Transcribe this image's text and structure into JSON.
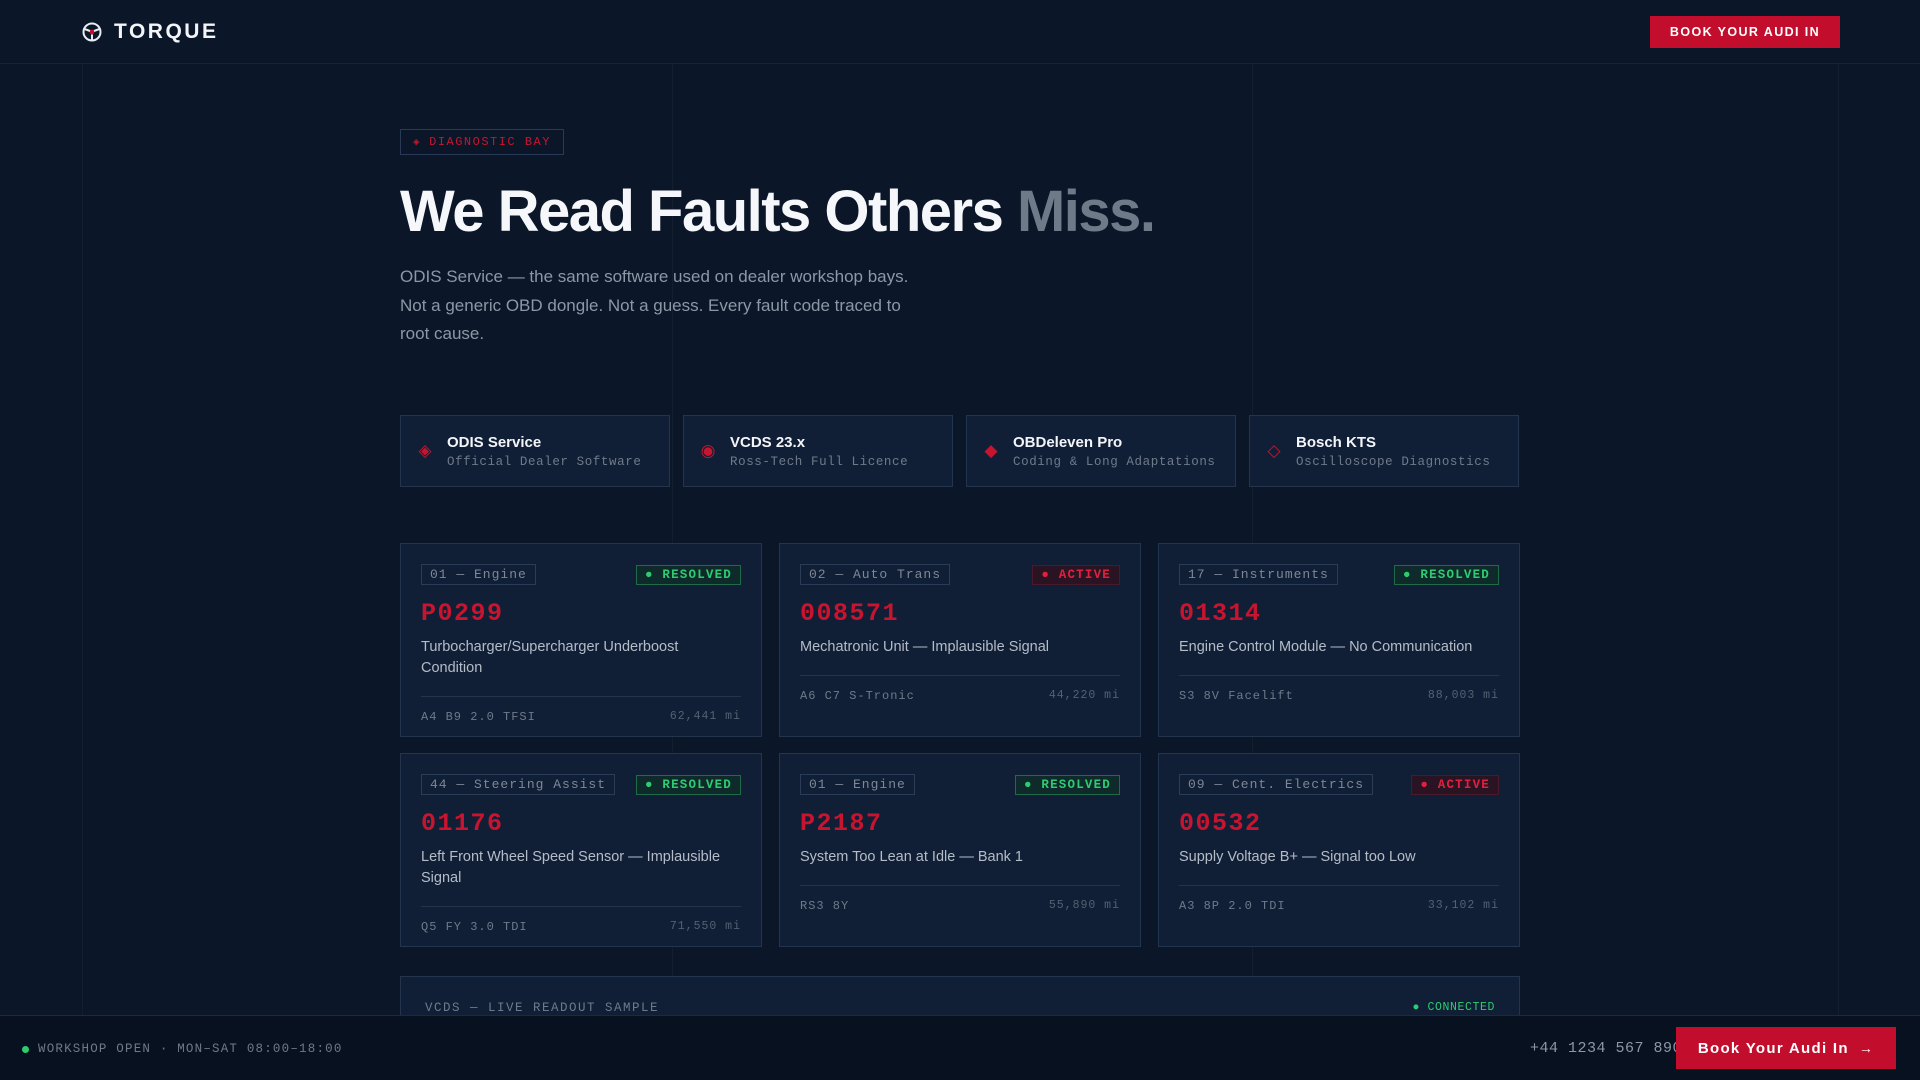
{
  "brand": {
    "name": "TORQUE",
    "icon": "steering-wheel-icon"
  },
  "header": {
    "cta_label": "BOOK YOUR AUDI IN"
  },
  "hero": {
    "tag_icon": "◈",
    "tag_label": "DIAGNOSTIC BAY",
    "title_main": "We Read Faults Others ",
    "title_muted": "Miss.",
    "subtitle": "ODIS Service — the same software used on dealer workshop bays. Not a generic OBD dongle. Not a guess. Every fault code traced to root cause."
  },
  "tools": [
    {
      "icon": "◈",
      "name": "ODIS Service",
      "desc": "Official Dealer Software"
    },
    {
      "icon": "◉",
      "name": "VCDS 23.x",
      "desc": "Ross-Tech Full Licence"
    },
    {
      "icon": "◆",
      "name": "OBDeleven Pro",
      "desc": "Coding & Long Adaptations"
    },
    {
      "icon": "◇",
      "name": "Bosch KTS",
      "desc": "Oscilloscope Diagnostics"
    }
  ],
  "faults": [
    {
      "module": "01 — Engine",
      "status": "● RESOLVED",
      "state": "resolved",
      "code": "P0299",
      "desc": "Turbocharger/Supercharger Underboost Condition",
      "car": "A4 B9 2.0 TFSI",
      "miles": "62,441 mi"
    },
    {
      "module": "02 — Auto Trans",
      "status": "● ACTIVE",
      "state": "active",
      "code": "008571",
      "desc": "Mechatronic Unit — Implausible Signal",
      "car": "A6 C7 S-Tronic",
      "miles": "44,220 mi"
    },
    {
      "module": "17 — Instruments",
      "status": "● RESOLVED",
      "state": "resolved",
      "code": "01314",
      "desc": "Engine Control Module — No Communication",
      "car": "S3 8V Facelift",
      "miles": "88,003 mi"
    },
    {
      "module": "44 — Steering Assist",
      "status": "● RESOLVED",
      "state": "resolved",
      "code": "01176",
      "desc": "Left Front Wheel Speed Sensor — Implausible Signal",
      "car": "Q5 FY 3.0 TDI",
      "miles": "71,550 mi"
    },
    {
      "module": "01 — Engine",
      "status": "● RESOLVED",
      "state": "resolved",
      "code": "P2187",
      "desc": "System Too Lean at Idle — Bank 1",
      "car": "RS3 8Y",
      "miles": "55,890 mi"
    },
    {
      "module": "09 — Cent. Electrics",
      "status": "● ACTIVE",
      "state": "active",
      "code": "00532",
      "desc": "Supply Voltage B+ — Signal too Low",
      "car": "A3 8P 2.0 TDI",
      "miles": "33,102 mi"
    }
  ],
  "readout": {
    "title": "VCDS — LIVE READOUT SAMPLE",
    "status": "● CONNECTED"
  },
  "bottombar": {
    "status": "WORKSHOP OPEN · MON–SAT 08:00–18:00",
    "phone": "+44 1234 567 890",
    "cta_label": "Book Your Audi In",
    "cta_icon": "→"
  },
  "colors": {
    "accent": "#c20e2c",
    "background": "#0b1628",
    "card": "#111f36",
    "success": "#2ecc71"
  }
}
